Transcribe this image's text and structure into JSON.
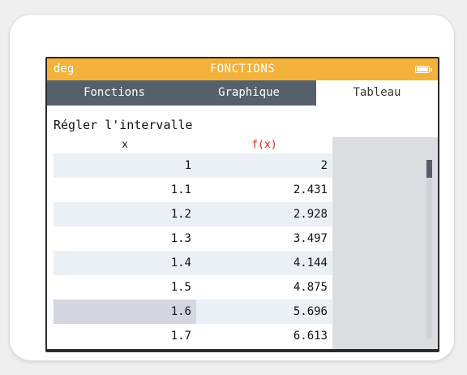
{
  "statusbar": {
    "angle_mode": "deg",
    "title": "FONCTIONS"
  },
  "tabs": [
    {
      "label": "Fonctions"
    },
    {
      "label": "Graphique"
    },
    {
      "label": "Tableau"
    }
  ],
  "active_tab": "Tableau",
  "interval_label": "Régler l'intervalle",
  "table": {
    "headers": {
      "x": "x",
      "f": "f(x)"
    },
    "rows": [
      {
        "x": "1",
        "f": "2"
      },
      {
        "x": "1.1",
        "f": "2.431"
      },
      {
        "x": "1.2",
        "f": "2.928"
      },
      {
        "x": "1.3",
        "f": "3.497"
      },
      {
        "x": "1.4",
        "f": "4.144"
      },
      {
        "x": "1.5",
        "f": "4.875"
      },
      {
        "x": "1.6",
        "f": "5.696"
      },
      {
        "x": "1.7",
        "f": "6.613"
      }
    ],
    "selected_row": 6
  },
  "colors": {
    "statusbar": "#f3b23c",
    "tabbar": "#56606b",
    "function_header": "#e2231a",
    "row_stripe": "#eaf0f6",
    "selected_cell": "#d4d6e2"
  }
}
